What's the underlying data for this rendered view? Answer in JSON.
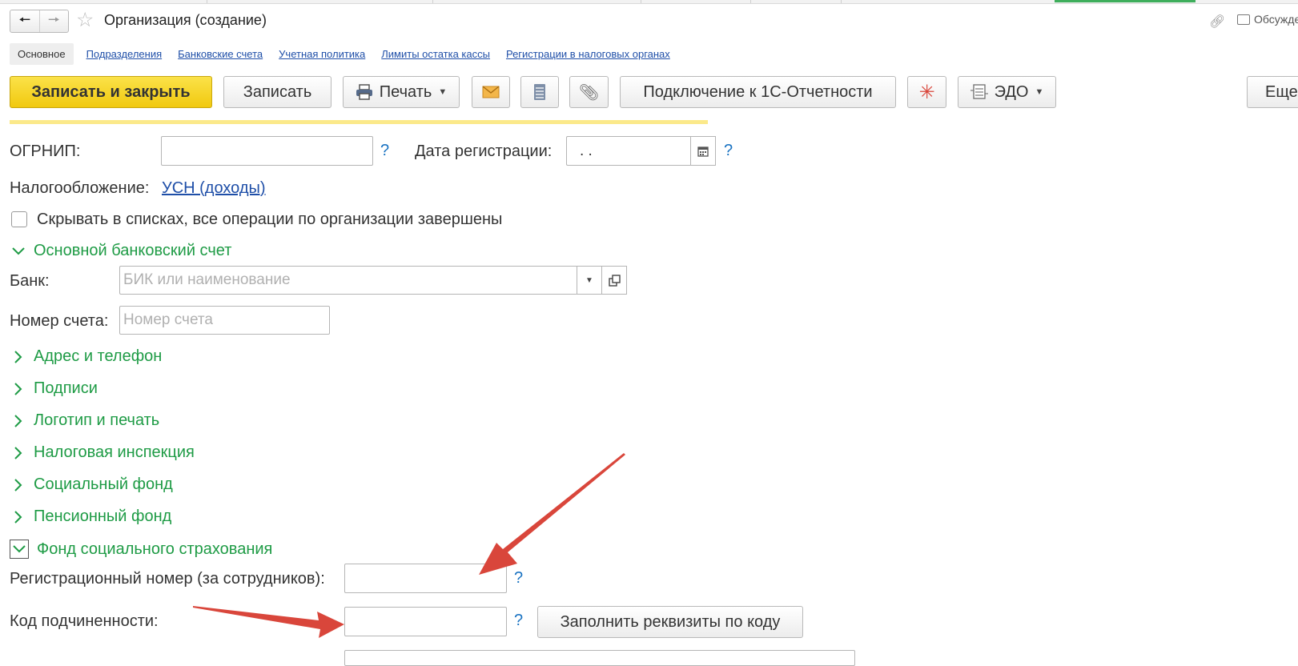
{
  "header": {
    "title": "Организация (создание)",
    "discuss_label": "Обсуждение"
  },
  "subtabs": [
    "Основное",
    "Подразделения",
    "Банковские счета",
    "Учетная политика",
    "Лимиты остатка кассы",
    "Регистрации в налоговых органах"
  ],
  "toolbar": {
    "save_close": "Записать и закрыть",
    "save": "Записать",
    "print": "Печать",
    "connect": "Подключение к 1С-Отчетности",
    "edo": "ЭДО",
    "more": "Еще"
  },
  "form": {
    "ogrnip_label": "ОГРНИП:",
    "help": "?",
    "reg_date_label": "Дата регистрации:",
    "reg_date_value": " .  .",
    "tax_label": "Налогообложение:",
    "tax_value": "УСН (доходы)",
    "hide_checkbox_label": "Скрывать в списках, все операции по организации завершены",
    "bank_section": "Основной банковский счет",
    "bank_label": "Банк:",
    "bank_placeholder": "БИК или наименование",
    "account_label": "Номер счета:",
    "account_placeholder": "Номер счета",
    "sections_collapsed": [
      "Адрес и телефон",
      "Подписи",
      "Логотип и печать",
      "Налоговая инспекция",
      "Социальный фонд",
      "Пенсионный фонд"
    ],
    "fss_section": "Фонд социального страхования",
    "reg_number_label": "Регистрационный номер (за сотрудников):",
    "sub_code_label": "Код подчиненности:",
    "fill_button": "Заполнить реквизиты по коду"
  },
  "colors": {
    "accent_green": "#1e9b45",
    "primary_yellow": "#f1c90f",
    "link_blue": "#1f4fa8",
    "annotation_red": "#d9463b"
  }
}
